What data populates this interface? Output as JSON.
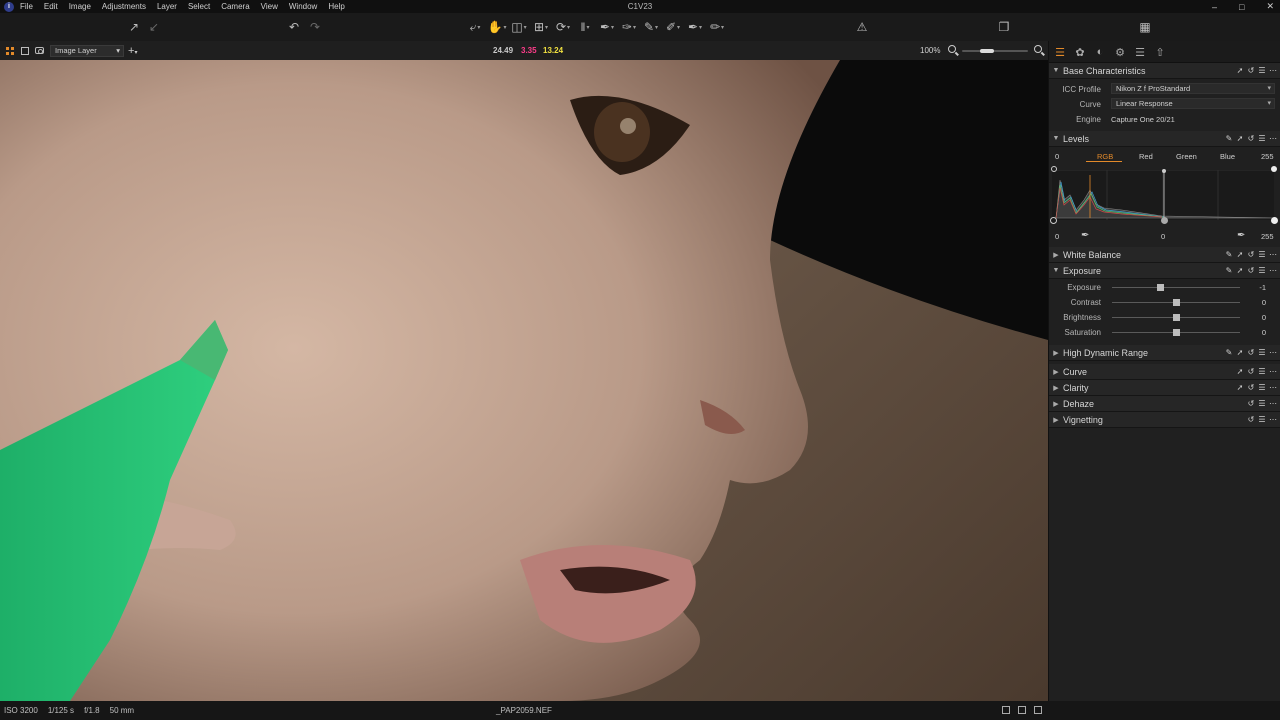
{
  "app": {
    "title": "C1V23",
    "menu": [
      "File",
      "Edit",
      "Image",
      "Adjustments",
      "Layer",
      "Select",
      "Camera",
      "View",
      "Window",
      "Help"
    ]
  },
  "viewer_header": {
    "layer": "Image Layer",
    "readout": {
      "r": "24.49",
      "g": "3.35",
      "b": "13.24"
    },
    "zoom": "100%"
  },
  "panel": {
    "base": {
      "title": "Base Characteristics",
      "icc_label": "ICC Profile",
      "icc_value": "Nikon Z f ProStandard",
      "curve_label": "Curve",
      "curve_value": "Linear Response",
      "engine_label": "Engine",
      "engine_value": "Capture One 20/21"
    },
    "levels": {
      "title": "Levels",
      "tabs": [
        "RGB",
        "Red",
        "Green",
        "Blue"
      ],
      "top_left": "0",
      "top_right": "255",
      "bottom_left": "0",
      "bottom_mid": "0",
      "bottom_right": "255"
    },
    "white_balance": {
      "title": "White Balance"
    },
    "exposure": {
      "title": "Exposure",
      "sliders": [
        {
          "label": "Exposure",
          "value": "-1",
          "level": 0.38
        },
        {
          "label": "Contrast",
          "value": "0",
          "level": 0.5
        },
        {
          "label": "Brightness",
          "value": "0",
          "level": 0.5
        },
        {
          "label": "Saturation",
          "value": "0",
          "level": 0.5
        }
      ]
    },
    "collapsed": [
      "High Dynamic Range",
      "Curve",
      "Clarity",
      "Dehaze",
      "Vignetting"
    ]
  },
  "status": {
    "iso": "ISO 3200",
    "shutter": "1/125 s",
    "aperture": "f/1.8",
    "focal": "50 mm",
    "filename": "_PAP2059.NEF"
  },
  "colors": {
    "accent": "#e38a2a",
    "readout_r": "#e0e0e0",
    "readout_g": "#ff3d8b",
    "readout_b": "#f0e040"
  }
}
